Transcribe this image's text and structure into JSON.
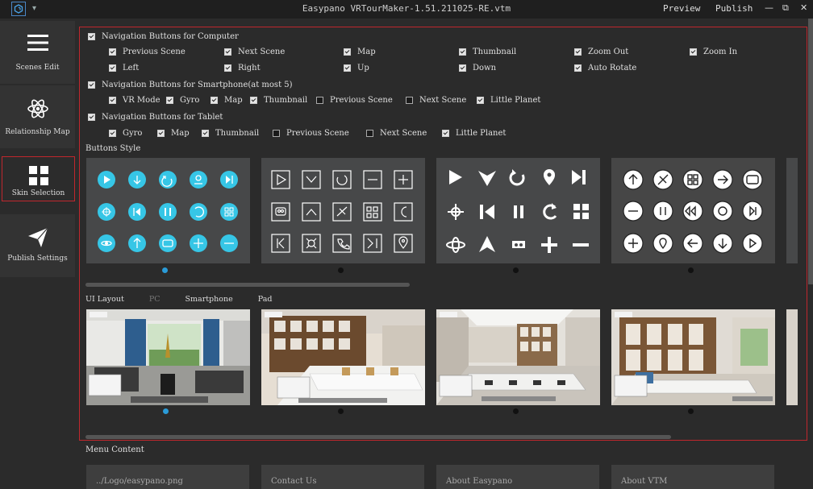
{
  "app": {
    "title": "Easypano VRTourMaker-1.51.211025-RE.vtm",
    "preview_label": "Preview",
    "publish_label": "Publish",
    "minimize_glyph": "—",
    "restore_glyph": "⧉",
    "close_glyph": "✕",
    "dropdown_glyph": "▾"
  },
  "sidebar": {
    "items": [
      {
        "label": "Scenes Edit",
        "icon": "menu-lines-icon"
      },
      {
        "label": "Relationship Map",
        "icon": "atom-icon"
      },
      {
        "label": "Skin Selection",
        "icon": "grid-icon"
      },
      {
        "label": "Publish Settings",
        "icon": "send-arrow-icon"
      }
    ]
  },
  "computer_nav": {
    "label": "Navigation Buttons for Computer",
    "checked": true,
    "options": [
      {
        "label": "Previous Scene",
        "checked": true
      },
      {
        "label": "Next Scene",
        "checked": true
      },
      {
        "label": "Map",
        "checked": true
      },
      {
        "label": "Thumbnail",
        "checked": true
      },
      {
        "label": "Zoom Out",
        "checked": true
      },
      {
        "label": "Zoom In",
        "checked": true
      },
      {
        "label": "Left",
        "checked": true
      },
      {
        "label": "Right",
        "checked": true
      },
      {
        "label": "Up",
        "checked": true
      },
      {
        "label": "Down",
        "checked": true
      },
      {
        "label": "Auto Rotate",
        "checked": true
      }
    ]
  },
  "smartphone_nav": {
    "label": "Navigation Buttons for Smartphone(at most 5)",
    "checked": true,
    "options": [
      {
        "label": "VR Mode",
        "checked": true
      },
      {
        "label": "Gyro",
        "checked": true
      },
      {
        "label": "Map",
        "checked": true
      },
      {
        "label": "Thumbnail",
        "checked": true
      },
      {
        "label": "Previous Scene",
        "checked": false
      },
      {
        "label": "Next Scene",
        "checked": false
      },
      {
        "label": "Little Planet",
        "checked": true
      }
    ]
  },
  "tablet_nav": {
    "label": "Navigation Buttons for Tablet",
    "checked": true,
    "options": [
      {
        "label": "Gyro",
        "checked": true
      },
      {
        "label": "Map",
        "checked": true
      },
      {
        "label": "Thumbnail",
        "checked": true
      },
      {
        "label": "Previous Scene",
        "checked": false
      },
      {
        "label": "Next Scene",
        "checked": false
      },
      {
        "label": "Little Planet",
        "checked": true
      }
    ]
  },
  "buttons_style": {
    "label": "Buttons Style",
    "styles": [
      "style-1",
      "style-2",
      "style-3",
      "style-4"
    ],
    "selected_index": 0
  },
  "ui_layout": {
    "label": "UI Layout",
    "tabs": [
      "PC",
      "Smartphone",
      "Pad"
    ],
    "selected_tab": "PC",
    "selected_index": 0
  },
  "menu_content": {
    "label": "Menu Content",
    "cards": [
      "../Logo/easypano.png",
      "Contact Us",
      "About Easypano",
      "About VTM"
    ]
  },
  "colors": {
    "accent_red": "#c0272d",
    "accent_blue": "#2a9bd8",
    "cyan_button": "#36c6e6"
  }
}
